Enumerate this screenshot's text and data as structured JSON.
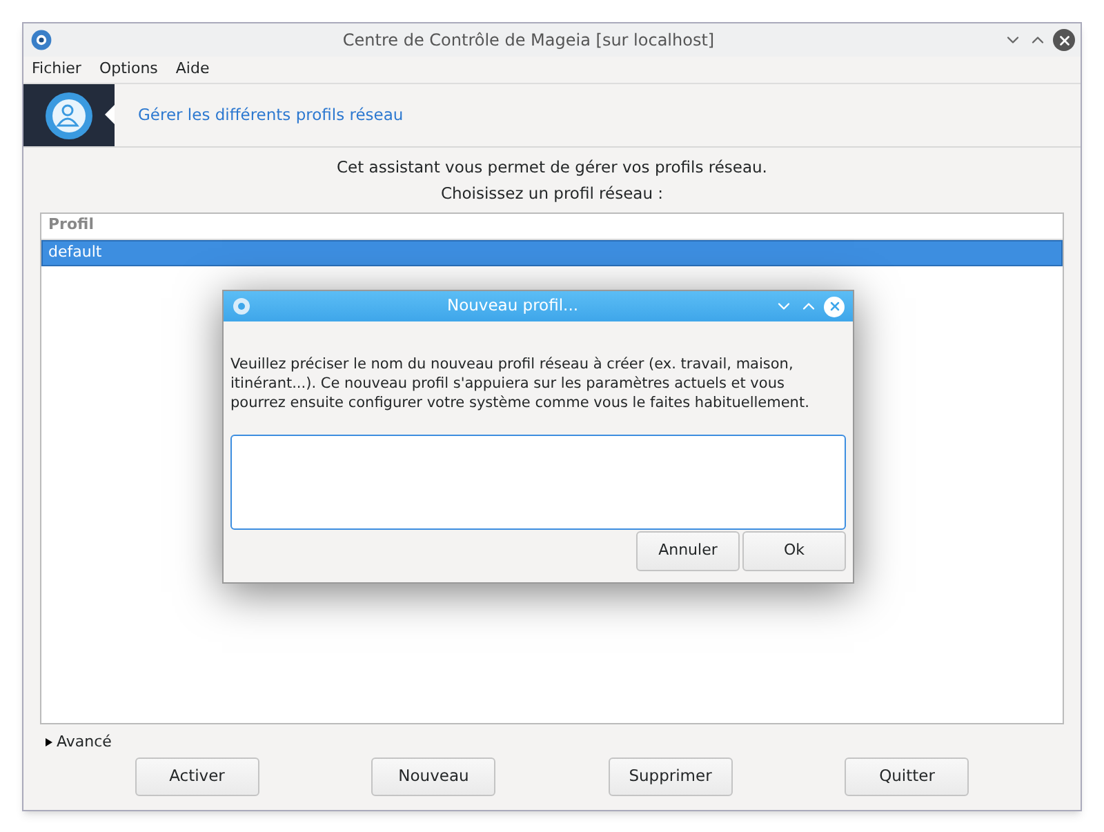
{
  "window": {
    "title": "Centre de Contrôle de Mageia [sur localhost]"
  },
  "menu": [
    "Fichier",
    "Options",
    "Aide"
  ],
  "banner": {
    "title": "Gérer les différents profils réseau"
  },
  "intro": [
    "Cet assistant vous permet de gérer vos profils réseau.",
    "Choisissez un profil réseau :"
  ],
  "table": {
    "columns": [
      "Profil"
    ],
    "rows": [
      {
        "name": "default",
        "selected": true
      }
    ]
  },
  "advanced": {
    "label": "Avancé",
    "expanded": false
  },
  "buttons": [
    "Activer",
    "Nouveau",
    "Supprimer",
    "Quitter"
  ],
  "dialog": {
    "title": "Nouveau profil...",
    "message": "Veuillez préciser le nom du nouveau profil réseau à créer (ex. travail, maison, itinérant...). Ce nouveau profil s'appuiera sur les paramètres actuels et vous pourrez ensuite configurer votre système comme vous le faites habituellement.",
    "buttons": [
      "Annuler",
      "Ok"
    ]
  }
}
